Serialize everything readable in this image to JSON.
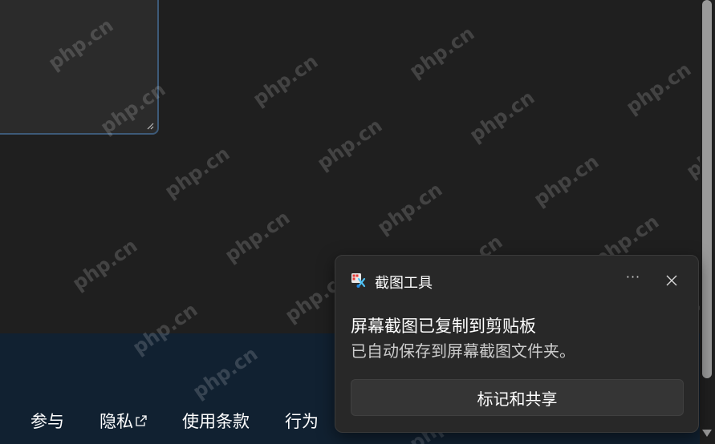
{
  "watermark": {
    "text": "php.cn"
  },
  "footer": {
    "links": [
      {
        "label": "参与"
      },
      {
        "label": "隐私"
      },
      {
        "label": "使用条款"
      },
      {
        "label": "行为"
      }
    ]
  },
  "toast": {
    "app_name": "截图工具",
    "more_label": "···",
    "title": "屏幕截图已复制到剪贴板",
    "body": "已自动保存到屏幕截图文件夹。",
    "action_label": "标记和共享"
  },
  "icons": {
    "app": "snipping-tool-icon",
    "close": "close-icon",
    "more": "more-options-icon",
    "external": "external-link-icon"
  },
  "colors": {
    "page_background": "#1f1f1f",
    "footer_background": "#112131",
    "toast_background": "#282828",
    "textarea_border": "#3d5a78"
  }
}
